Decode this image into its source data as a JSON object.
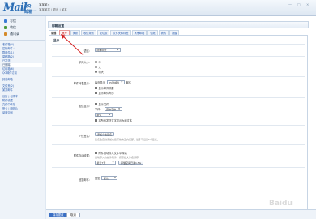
{
  "header": {
    "logo_mail": "Mail",
    "logo_sub": "QQ邮箱",
    "logo_domain": "mail.qq.com",
    "user_line1": "某某某<",
    "user_line2": "某某某某 | 退出 | 某某",
    "user_link": "某某",
    "win_controls": [
      "—",
      "□",
      "×"
    ]
  },
  "sidebar": {
    "buttons": [
      {
        "label": "写信",
        "color": "#3a7bd5"
      },
      {
        "label": "收信",
        "color": "#4a9a3b"
      },
      {
        "label": "通讯录",
        "color": "#d48a2a"
      }
    ],
    "items": [
      "收件箱(4)",
      "星标邮件☆",
      "群邮件(1)",
      "草稿箱(2)",
      "已发送",
      "已删除",
      "垃圾箱(6)",
      "QQ邮件订阅",
      "",
      "其他邮箱",
      "",
      "文件夹(2)",
      "某某邮件",
      "",
      "日历 | 记事本",
      "附件收藏",
      "文件中转站",
      "贺卡 | 明信片",
      "阅读空间"
    ],
    "active_index": 5
  },
  "main": {
    "title": "邮箱设置",
    "tabs": [
      "常规",
      "帐户",
      "换肤",
      "收信规则",
      "反垃圾",
      "文件夹和标签",
      "其他邮箱",
      "信纸",
      "我的",
      "提醒"
    ],
    "active_tab": 0,
    "highlight_tab": 1,
    "sections": {
      "general_title": "显示"
    },
    "rows": {
      "language_label": "语言：",
      "language_value": "简体中文",
      "fontsize_label": "字体大小：",
      "fontsize_options": [
        "中",
        "大",
        "特大"
      ],
      "fontsize_selected": 0,
      "list_label": "邮件列表显示：",
      "list_per_page": "每页显示",
      "list_count": "25封邮件",
      "list_count_suffix": "邮件",
      "list_opt1": "显示邮件摘要",
      "list_opt2": "显示邮件大小",
      "compose_label": "发信显示：",
      "compose_opt1": "显示发件",
      "compose_font_label": "字体：",
      "compose_font": "宋体字体",
      "compose_size": "默认",
      "compose_opt2": "将所有发送文字显示为纯文本",
      "sign_label": "个性签名：",
      "sign_button": "添加个性签名",
      "sign_hint": "签名会自动添加在您写信的正文底部，最多可设置5个签名。",
      "auto_label": "附件自动收藏：",
      "auto_opt": "附件自动存入文件中转站",
      "auto_hint": "自动存入的邮件附件：按原始文件名保存",
      "auto_select": "最近7天",
      "auto_button": "存储空间已满1.5G",
      "reply_label": "回复邮件：",
      "reply_opt": "回复",
      "reply_value": "默认"
    }
  },
  "footer": {
    "save_label": "保存更改",
    "cancel_label": "取消"
  },
  "watermark": "Baidu"
}
